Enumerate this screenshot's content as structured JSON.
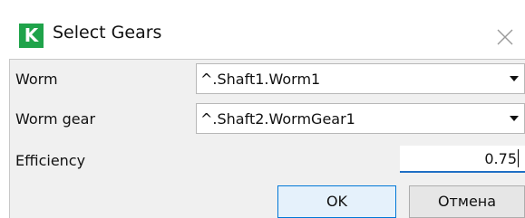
{
  "window": {
    "app_icon_letter": "K",
    "title": "Select Gears",
    "close_glyph": "close-icon"
  },
  "form": {
    "worm": {
      "label": "Worm",
      "value": "^.Shaft1.Worm1"
    },
    "worm_gear": {
      "label": "Worm gear",
      "value": "^.Shaft2.WormGear1"
    },
    "efficiency": {
      "label": "Efficiency",
      "value": "0.75"
    }
  },
  "buttons": {
    "ok_label": "OK",
    "cancel_label": "Отмена"
  },
  "colors": {
    "app_icon_bg": "#1fa34a",
    "focus_accent": "#1f6fc4",
    "default_button_border": "#0078d7",
    "panel_bg": "#f0f0f0"
  }
}
